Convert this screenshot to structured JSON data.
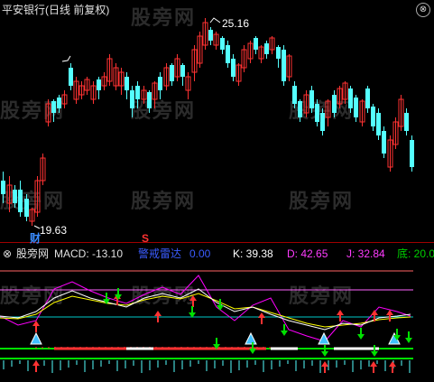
{
  "price_panel": {
    "title": "平安银行(日线 前复权)",
    "high_label": "25.16",
    "low_label": "19.63",
    "marker_cai": "财",
    "marker_s": "S",
    "close_symbol": "⊗"
  },
  "indicator_panel": {
    "close_symbol": "⊗",
    "site": "股旁网",
    "macd_label": "MACD: -13.10",
    "alert_label": "警戒雷达",
    "alert_value": "0.00",
    "k_label": "K: 39.38",
    "d_label": "D: 42.65",
    "j_label": "J: 32.84",
    "bottom_label": "底: 20.00"
  },
  "watermark": "股旁网",
  "colors": {
    "up": "#ff3232",
    "down": "#54ffff",
    "k_line": "#ffffff",
    "d_line": "#ffff00",
    "j_line": "#ff00ff",
    "green": "#00e000",
    "cyan_line": "#00c8c8"
  },
  "chart_data": {
    "type": "candlestick",
    "title": "平安银行(日线 前复权)",
    "annotations": {
      "high": 25.16,
      "low": 19.63
    },
    "note": "price candles approximate; trend falls to 19.63, rises to 25.16 peak, then declines"
  }
}
